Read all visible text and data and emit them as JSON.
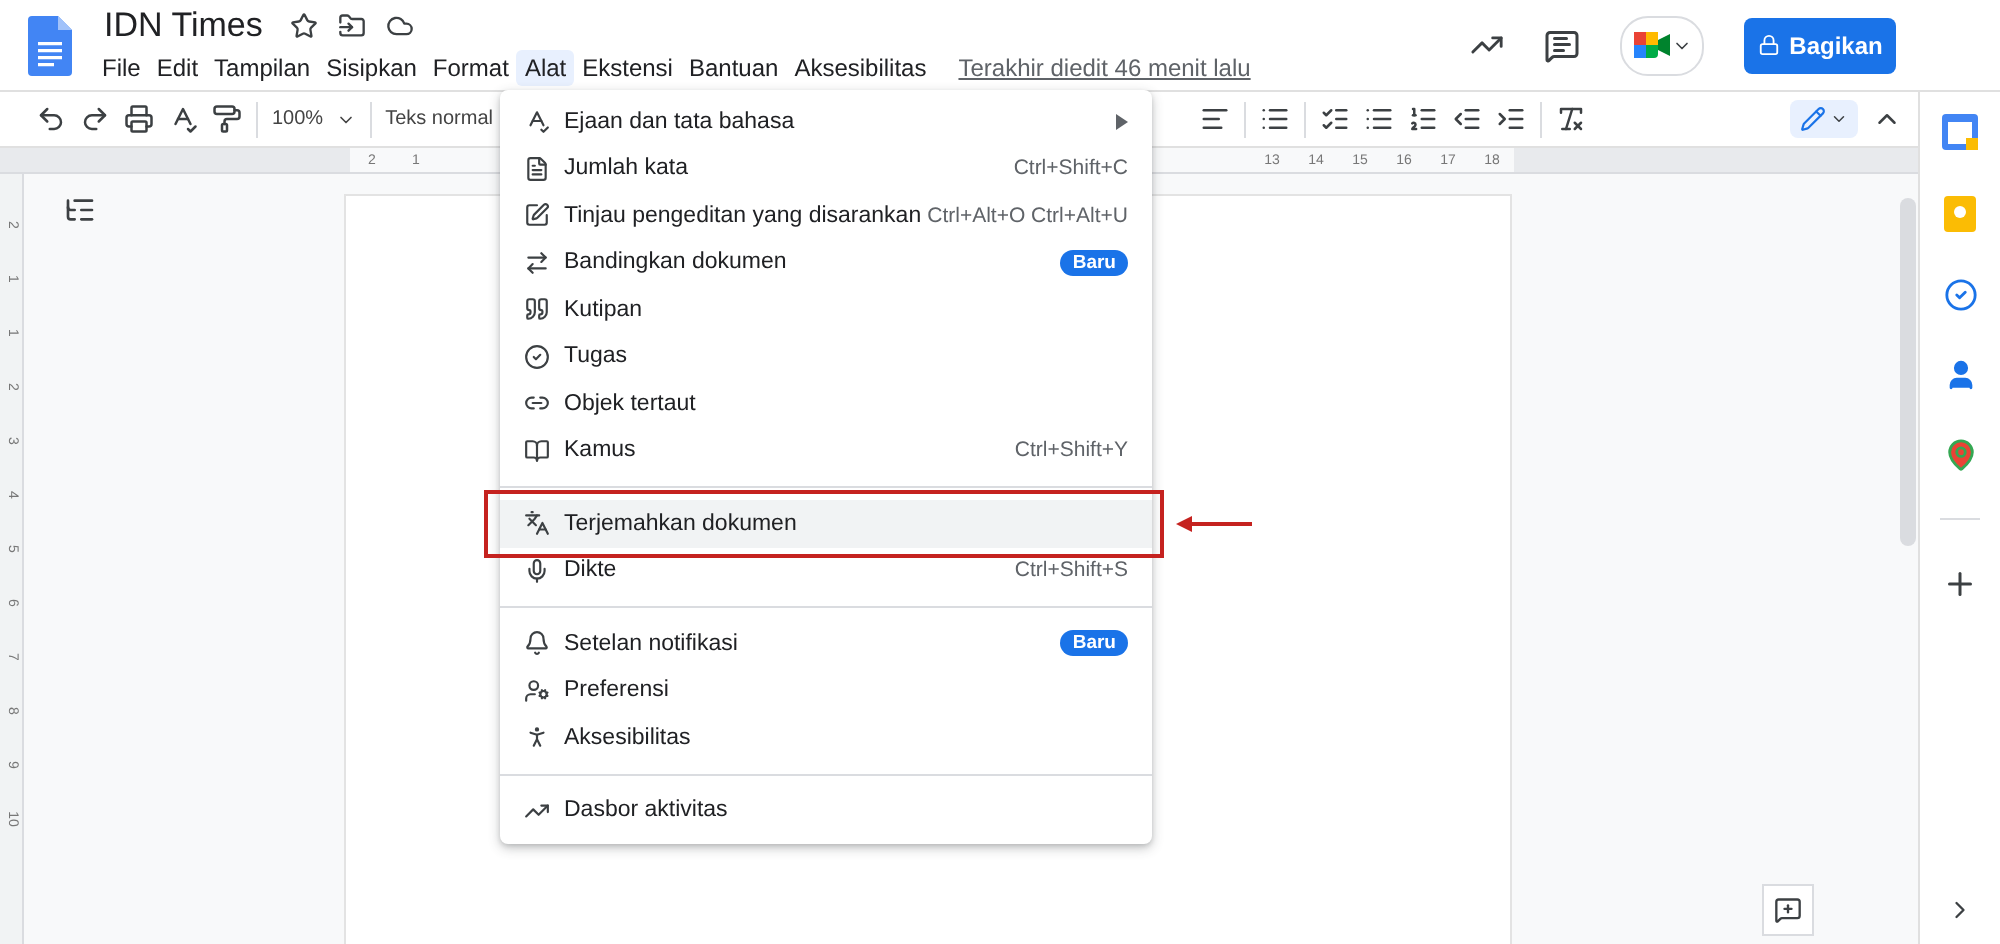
{
  "document": {
    "title": "IDN Times",
    "last_edit": "Terakhir diedit 46 menit lalu"
  },
  "menubar": [
    {
      "label": "File",
      "selected": false
    },
    {
      "label": "Edit",
      "selected": false
    },
    {
      "label": "Tampilan",
      "selected": false
    },
    {
      "label": "Sisipkan",
      "selected": false
    },
    {
      "label": "Format",
      "selected": false
    },
    {
      "label": "Alat",
      "selected": true
    },
    {
      "label": "Ekstensi",
      "selected": false
    },
    {
      "label": "Bantuan",
      "selected": false
    },
    {
      "label": "Aksesibilitas",
      "selected": false
    }
  ],
  "share_button": {
    "label": "Bagikan"
  },
  "toolbar": {
    "zoom": "100%",
    "style": "Teks normal"
  },
  "ruler": {
    "left_labels": [
      "2",
      "1"
    ],
    "right_labels": [
      "13",
      "14",
      "15",
      "16",
      "17",
      "18"
    ],
    "vertical_labels": [
      "2",
      "1",
      "1",
      "2",
      "3",
      "4",
      "5",
      "6",
      "7",
      "8",
      "9",
      "10"
    ]
  },
  "tools_menu": [
    {
      "kind": "item",
      "label": "Ejaan dan tata bahasa",
      "submenu": true,
      "highlighted": false,
      "annotated": false
    },
    {
      "kind": "item",
      "label": "Jumlah kata",
      "shortcut": "Ctrl+Shift+C",
      "highlighted": false,
      "annotated": false
    },
    {
      "kind": "item",
      "label": "Tinjau pengeditan yang disarankan",
      "shortcut": "Ctrl+Alt+O Ctrl+Alt+U",
      "highlighted": false,
      "annotated": false
    },
    {
      "kind": "item",
      "label": "Bandingkan dokumen",
      "badge": "Baru",
      "highlighted": false,
      "annotated": false
    },
    {
      "kind": "item",
      "label": "Kutipan",
      "highlighted": false,
      "annotated": false
    },
    {
      "kind": "item",
      "label": "Tugas",
      "highlighted": false,
      "annotated": false
    },
    {
      "kind": "item",
      "label": "Objek tertaut",
      "highlighted": false,
      "annotated": false
    },
    {
      "kind": "item",
      "label": "Kamus",
      "shortcut": "Ctrl+Shift+Y",
      "highlighted": false,
      "annotated": false
    },
    {
      "kind": "separator"
    },
    {
      "kind": "item",
      "label": "Terjemahkan dokumen",
      "highlighted": true,
      "annotated": true
    },
    {
      "kind": "item",
      "label": "Dikte",
      "shortcut": "Ctrl+Shift+S",
      "highlighted": false,
      "annotated": false
    },
    {
      "kind": "separator"
    },
    {
      "kind": "item",
      "label": "Setelan notifikasi",
      "badge": "Baru",
      "highlighted": false,
      "annotated": false
    },
    {
      "kind": "item",
      "label": "Preferensi",
      "highlighted": false,
      "annotated": false
    },
    {
      "kind": "item",
      "label": "Aksesibilitas",
      "highlighted": false,
      "annotated": false
    },
    {
      "kind": "separator"
    },
    {
      "kind": "item",
      "label": "Dasbor aktivitas",
      "highlighted": false,
      "annotated": false
    }
  ]
}
